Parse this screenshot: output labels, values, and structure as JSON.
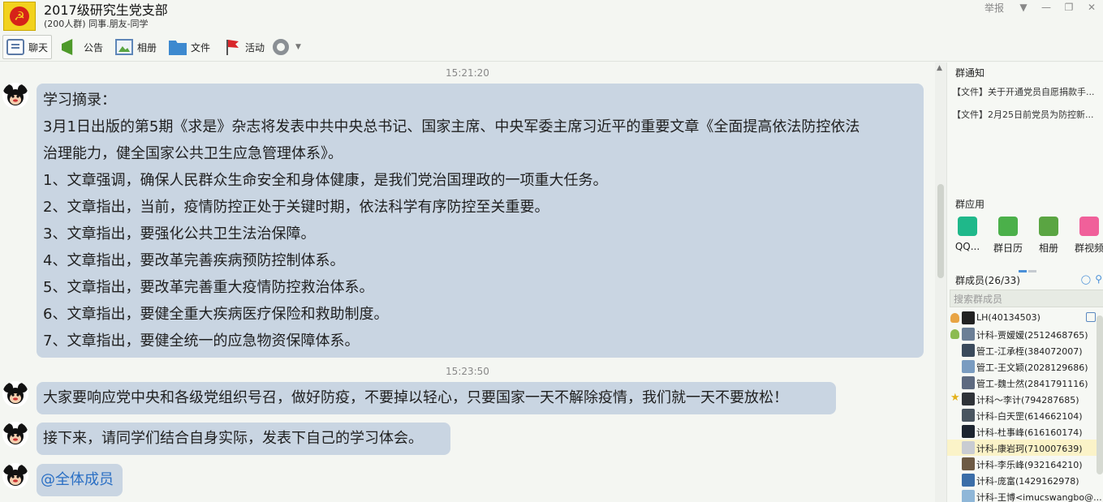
{
  "header": {
    "title": "2017级研究生党支部",
    "subtitle": "(200人群) 同事.朋友-同学",
    "report": "举报",
    "report_caret": "▼"
  },
  "toolbar": {
    "chat": "聊天",
    "notice": "公告",
    "album": "相册",
    "file": "文件",
    "event": "活动",
    "more_caret": "▼"
  },
  "messages": {
    "ts1": "15:21:20",
    "ts2": "15:23:50",
    "main_lines": [
      "学习摘录：",
      "3月1日出版的第5期《求是》杂志将发表中共中央总书记、国家主席、中央军委主席习近平的重要文章《全面提高依法防控依法",
      "治理能力，健全国家公共卫生应急管理体系》。",
      "1、文章强调，确保人民群众生命安全和身体健康，是我们党治国理政的一项重大任务。",
      "2、文章指出，当前，疫情防控正处于关键时期，依法科学有序防控至关重要。",
      "3、文章指出，要强化公共卫生法治保障。",
      "4、文章指出，要改革完善疾病预防控制体系。",
      "5、文章指出，要改革完善重大疫情防控救治体系。",
      "6、文章指出，要健全重大疾病医疗保险和救助制度。",
      "7、文章指出，要健全统一的应急物资保障体系。"
    ],
    "msg2": "大家要响应党中央和各级党组织号召，做好防疫，不要掉以轻心，只要国家一天不解除疫情，我们就一天不要放松！",
    "msg3": "接下来，请同学们结合自身实际，发表下自己的学习体会。",
    "msg4": "@全体成员"
  },
  "sidebar": {
    "notice_title": "群通知",
    "notices": [
      "【文件】关于开通党员自愿捐款手...",
      "【文件】2月25日前党员为防控新..."
    ],
    "apps_title": "群应用",
    "apps": [
      {
        "label": "QQ...",
        "color": "#1fb88a"
      },
      {
        "label": "群日历",
        "color": "#4bb04a"
      },
      {
        "label": "相册",
        "color": "#5aa542"
      },
      {
        "label": "群视频",
        "color": "#f0609a"
      }
    ],
    "members_title": "群成员(26/33)",
    "search_placeholder": "搜索群成员",
    "members": [
      {
        "name": "LH(40134503)",
        "badge": "owner"
      },
      {
        "name": "计科-贾嫒嫒(2512468765)",
        "badge": "admin"
      },
      {
        "name": "管工-江承桎(384072007)",
        "badge": ""
      },
      {
        "name": "管工-王文颖(2028129686)",
        "badge": ""
      },
      {
        "name": "管工-魏士然(2841791116)",
        "badge": ""
      },
      {
        "name": "计科～李计(794287685)",
        "badge": "star"
      },
      {
        "name": "计科-白天罡(614662104)",
        "badge": ""
      },
      {
        "name": "计科-杜事峰(616160174)",
        "badge": ""
      },
      {
        "name": "计科-康岩珂(710007639)",
        "badge": "",
        "selected": true
      },
      {
        "name": "计科-李乐峰(932164210)",
        "badge": ""
      },
      {
        "name": "计科-庞富(1429162978)",
        "badge": ""
      },
      {
        "name": "计科-王博<imucswangbo@...",
        "badge": ""
      }
    ]
  },
  "colors": {
    "bubble": "#c9d5e2",
    "mention": "#2a6fc4",
    "selected_row": "#fbf3c8"
  }
}
